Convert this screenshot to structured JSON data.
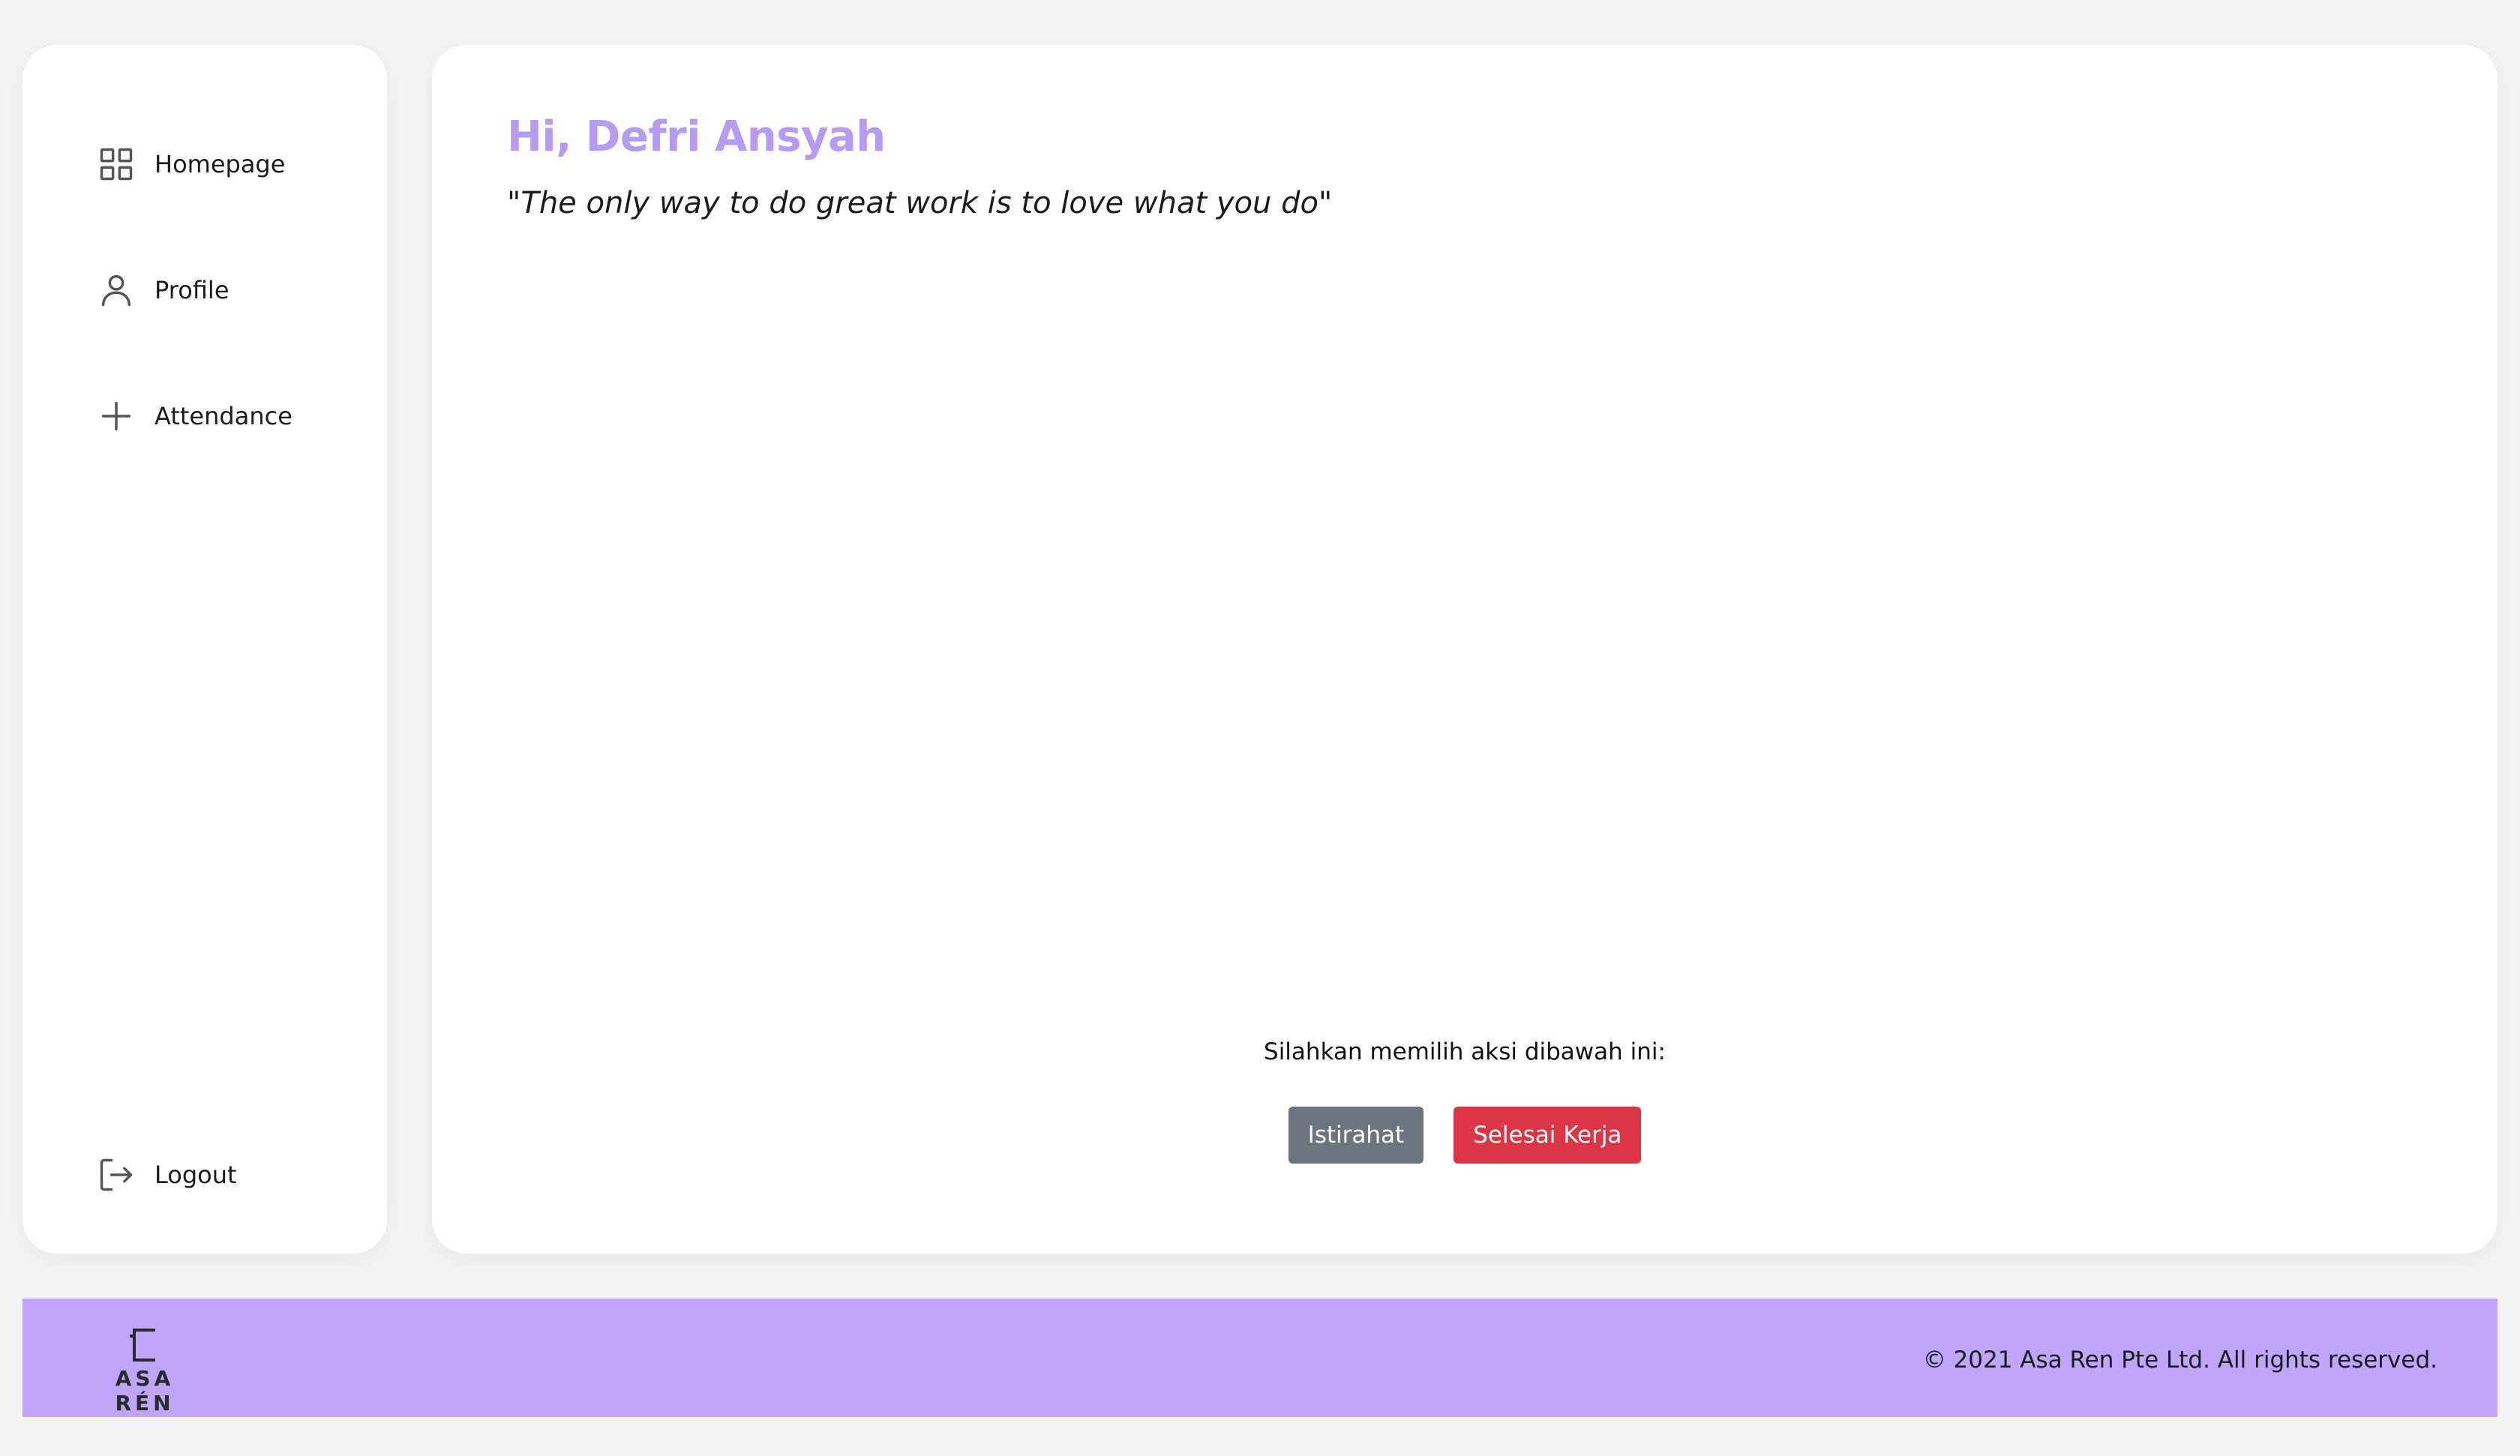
{
  "sidebar": {
    "items": [
      {
        "label": "Homepage",
        "icon": "grid-icon"
      },
      {
        "label": "Profile",
        "icon": "user-icon"
      },
      {
        "label": "Attendance",
        "icon": "plus-icon"
      }
    ],
    "logout": {
      "label": "Logout",
      "icon": "logout-icon"
    }
  },
  "main": {
    "greeting": "Hi, Defri Ansyah",
    "quote": "\"The only way to do great work is to love what you do\"",
    "action_prompt": "Silahkan memilih aksi dibawah ini:",
    "buttons": {
      "rest": "Istirahat",
      "finish": "Selesai Kerja"
    }
  },
  "footer": {
    "logo_text": "ASA RÉN",
    "copyright": "© 2021 Asa Ren Pte Ltd. All rights reserved."
  },
  "colors": {
    "accent": "#c0a6fb",
    "greeting": "#b69bf4",
    "rest_button": "#6c747e",
    "finish_button": "#dc3545",
    "background": "#f4f4f4"
  }
}
